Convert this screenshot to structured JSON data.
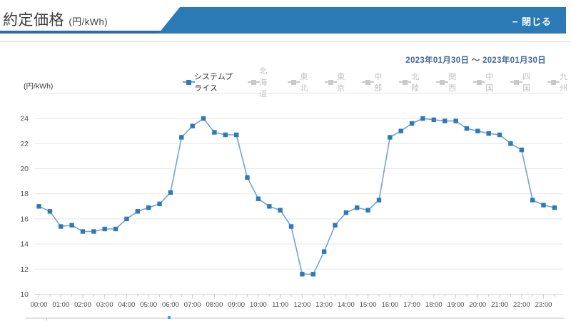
{
  "header": {
    "title": "約定価格",
    "title_unit": "(円/kWh)",
    "close_label": "− 閉じる"
  },
  "date_range": {
    "from": "2023年01月30日",
    "separator": "〜",
    "to": "2023年01月30日",
    "display": "2023年01月30日 〜 2023年01月30日"
  },
  "legend": {
    "active_marker_color": "#2f79b8",
    "active_line_color": "#6aa2d8",
    "inactive_color": "#c9c9c9",
    "items": [
      {
        "label": "システムプライス",
        "active": true
      },
      {
        "label": "北海道",
        "active": false
      },
      {
        "label": "東北",
        "active": false
      },
      {
        "label": "東京",
        "active": false
      },
      {
        "label": "中部",
        "active": false
      },
      {
        "label": "北陸",
        "active": false
      },
      {
        "label": "関西",
        "active": false
      },
      {
        "label": "中国",
        "active": false
      },
      {
        "label": "四国",
        "active": false
      },
      {
        "label": "九州",
        "active": false
      }
    ]
  },
  "chart_data": {
    "type": "line",
    "title": "",
    "ylabel": "(円/kWh)",
    "xlabel": "",
    "grid": true,
    "ylim": [
      10,
      26
    ],
    "ytick_step": 2,
    "ytick_label_max": 24,
    "x_hour_labels": [
      "00:00",
      "01:00",
      "02:00",
      "03:00",
      "04:00",
      "05:00",
      "06:00",
      "07:00",
      "08:00",
      "09:00",
      "10:00",
      "11:00",
      "12:00",
      "13:00",
      "14:00",
      "15:00",
      "16:00",
      "17:00",
      "18:00",
      "19:00",
      "20:00",
      "21:00",
      "22:00",
      "23:00"
    ],
    "x": [
      "00:00",
      "00:30",
      "01:00",
      "01:30",
      "02:00",
      "02:30",
      "03:00",
      "03:30",
      "04:00",
      "04:30",
      "05:00",
      "05:30",
      "06:00",
      "06:30",
      "07:00",
      "07:30",
      "08:00",
      "08:30",
      "09:00",
      "09:30",
      "10:00",
      "10:30",
      "11:00",
      "11:30",
      "12:00",
      "12:30",
      "13:00",
      "13:30",
      "14:00",
      "14:30",
      "15:00",
      "15:30",
      "16:00",
      "16:30",
      "17:00",
      "17:30",
      "18:00",
      "18:30",
      "19:00",
      "19:30",
      "20:00",
      "20:30",
      "21:00",
      "21:30",
      "22:00",
      "22:30",
      "23:00",
      "23:30"
    ],
    "series": [
      {
        "name": "システムプライス",
        "marker_color": "#2f79b8",
        "line_color": "#71a4d9",
        "values": [
          17.0,
          16.6,
          15.4,
          15.5,
          15.0,
          15.0,
          15.2,
          15.2,
          16.0,
          16.6,
          16.9,
          17.2,
          18.1,
          22.5,
          23.4,
          24.0,
          22.9,
          22.7,
          22.7,
          19.3,
          17.6,
          17.0,
          16.7,
          15.4,
          11.6,
          11.6,
          13.4,
          15.5,
          16.5,
          16.9,
          16.7,
          17.5,
          22.5,
          23.0,
          23.6,
          24.0,
          23.9,
          23.8,
          23.8,
          23.2,
          23.0,
          22.8,
          22.7,
          22.0,
          21.5,
          17.5,
          17.1,
          16.9
        ]
      }
    ]
  },
  "colors": {
    "banner_blue": "#2b7ab6",
    "underline_blue": "#2a6ca5",
    "date_text": "#47699c",
    "gridline": "#e7e7e7",
    "axis_line": "#d6d6d6",
    "tick": "#c7ced6",
    "y_label": "#555555",
    "x_label": "#45494e"
  }
}
